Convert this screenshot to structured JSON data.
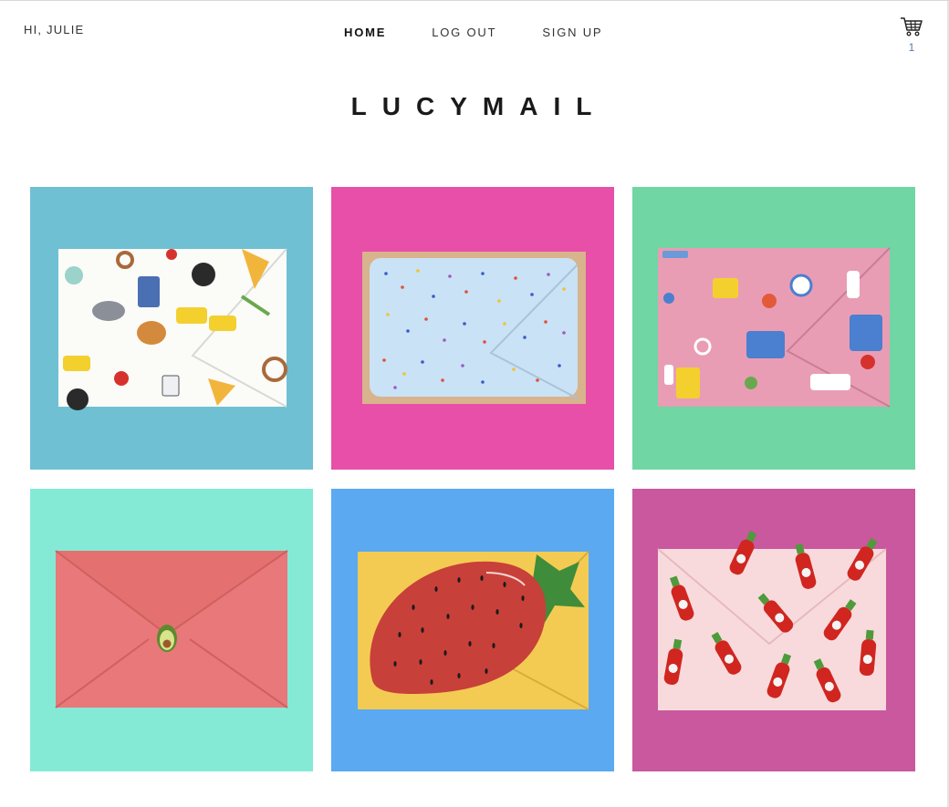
{
  "header": {
    "greeting": "HI, JULIE",
    "nav": [
      {
        "label": "HOME",
        "active": true
      },
      {
        "label": "LOG OUT",
        "active": false
      },
      {
        "label": "SIGN UP",
        "active": false
      }
    ],
    "cart_icon": "shopping-cart-icon",
    "cart_count": "1"
  },
  "brand": {
    "logo": "LUCYMAIL"
  },
  "products": [
    {
      "name": "new-york-envelope",
      "background": "#6fc0d3",
      "envelope": "#ffffff",
      "pattern": "new york icons"
    },
    {
      "name": "sprinkles-envelope",
      "background": "#e84fa8",
      "envelope": "#d9b48e",
      "pattern": "sprinkles"
    },
    {
      "name": "birth-control-envelope",
      "background": "#6fd6a4",
      "envelope": "#e99db4",
      "pattern": "birth control"
    },
    {
      "name": "avocado-envelope",
      "background": "#84ead6",
      "envelope": "#e8787a",
      "pattern": "avocado sticker"
    },
    {
      "name": "strawberry-envelope",
      "background": "#5aa9f1",
      "envelope": "#f4cb52",
      "pattern": "strawberry"
    },
    {
      "name": "sriracha-envelope",
      "background": "#c9589e",
      "envelope": "#f8dadd",
      "pattern": "sriracha"
    }
  ]
}
